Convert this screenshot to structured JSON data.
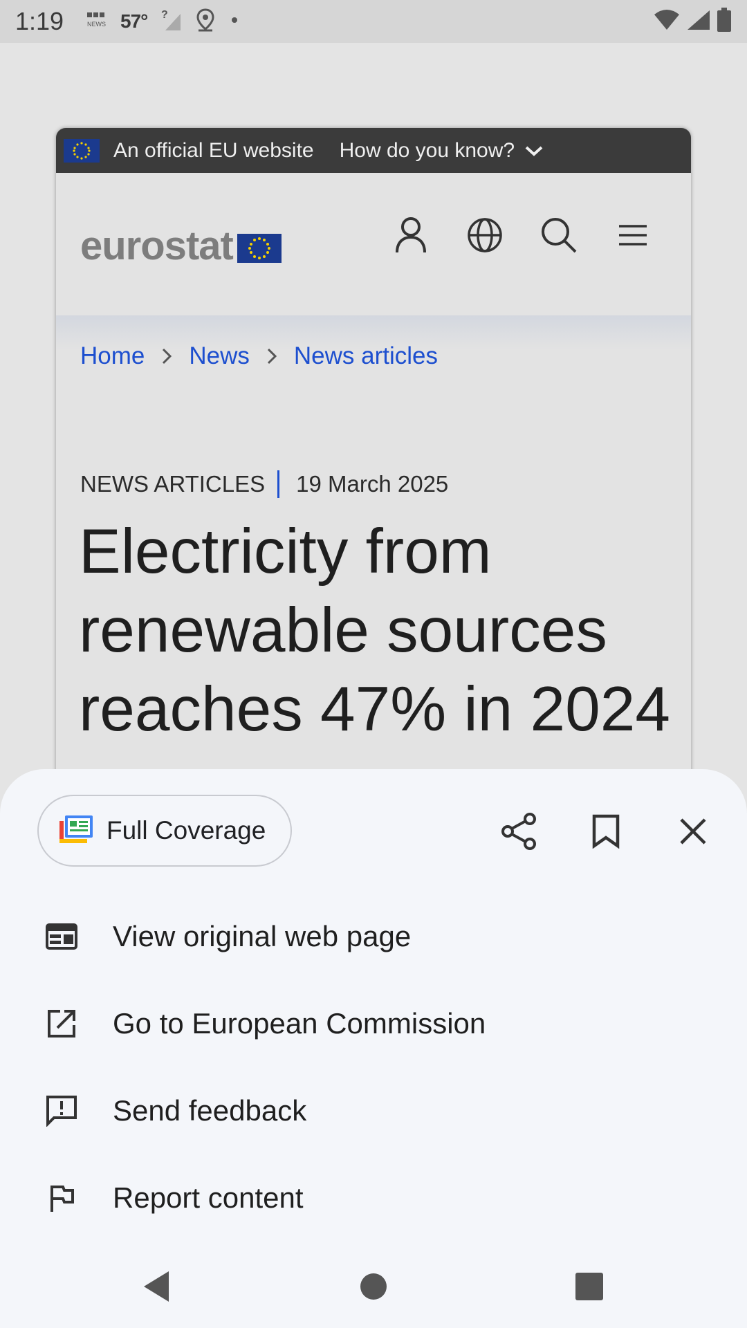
{
  "status_bar": {
    "time": "1:19",
    "temperature": "57°",
    "icons": [
      "news-icon",
      "weather-temp",
      "no-signal-icon",
      "location-icon",
      "dot-icon",
      "wifi-icon",
      "cell-signal-icon",
      "battery-icon"
    ]
  },
  "eu_banner": {
    "text": "An official EU website",
    "how": "How do you know?"
  },
  "site": {
    "logo_text": "eurostat",
    "icons": [
      "user-icon",
      "globe-icon",
      "search-icon",
      "menu-icon"
    ]
  },
  "breadcrumb": {
    "items": [
      "Home",
      "News",
      "News articles"
    ]
  },
  "article": {
    "category": "NEWS ARTICLES",
    "date": "19 March 2025",
    "headline": "Electricity from renewable sources reaches 47% in 2024"
  },
  "sheet": {
    "full_coverage_label": "Full Coverage",
    "actions": [
      "share-icon",
      "bookmark-icon",
      "close-icon"
    ],
    "menu": [
      {
        "label": "View original web page",
        "icon": "web-page-icon"
      },
      {
        "label": "Go to European Commission",
        "icon": "open-external-icon"
      },
      {
        "label": "Send feedback",
        "icon": "feedback-icon"
      },
      {
        "label": "Report content",
        "icon": "flag-icon"
      }
    ]
  },
  "colors": {
    "eu_blue": "#1b3a8e",
    "eu_gold": "#f5d000",
    "link_blue": "#1d4fcf",
    "banner_dark": "#3b3b3b",
    "sheet_bg": "#f4f6fa"
  }
}
